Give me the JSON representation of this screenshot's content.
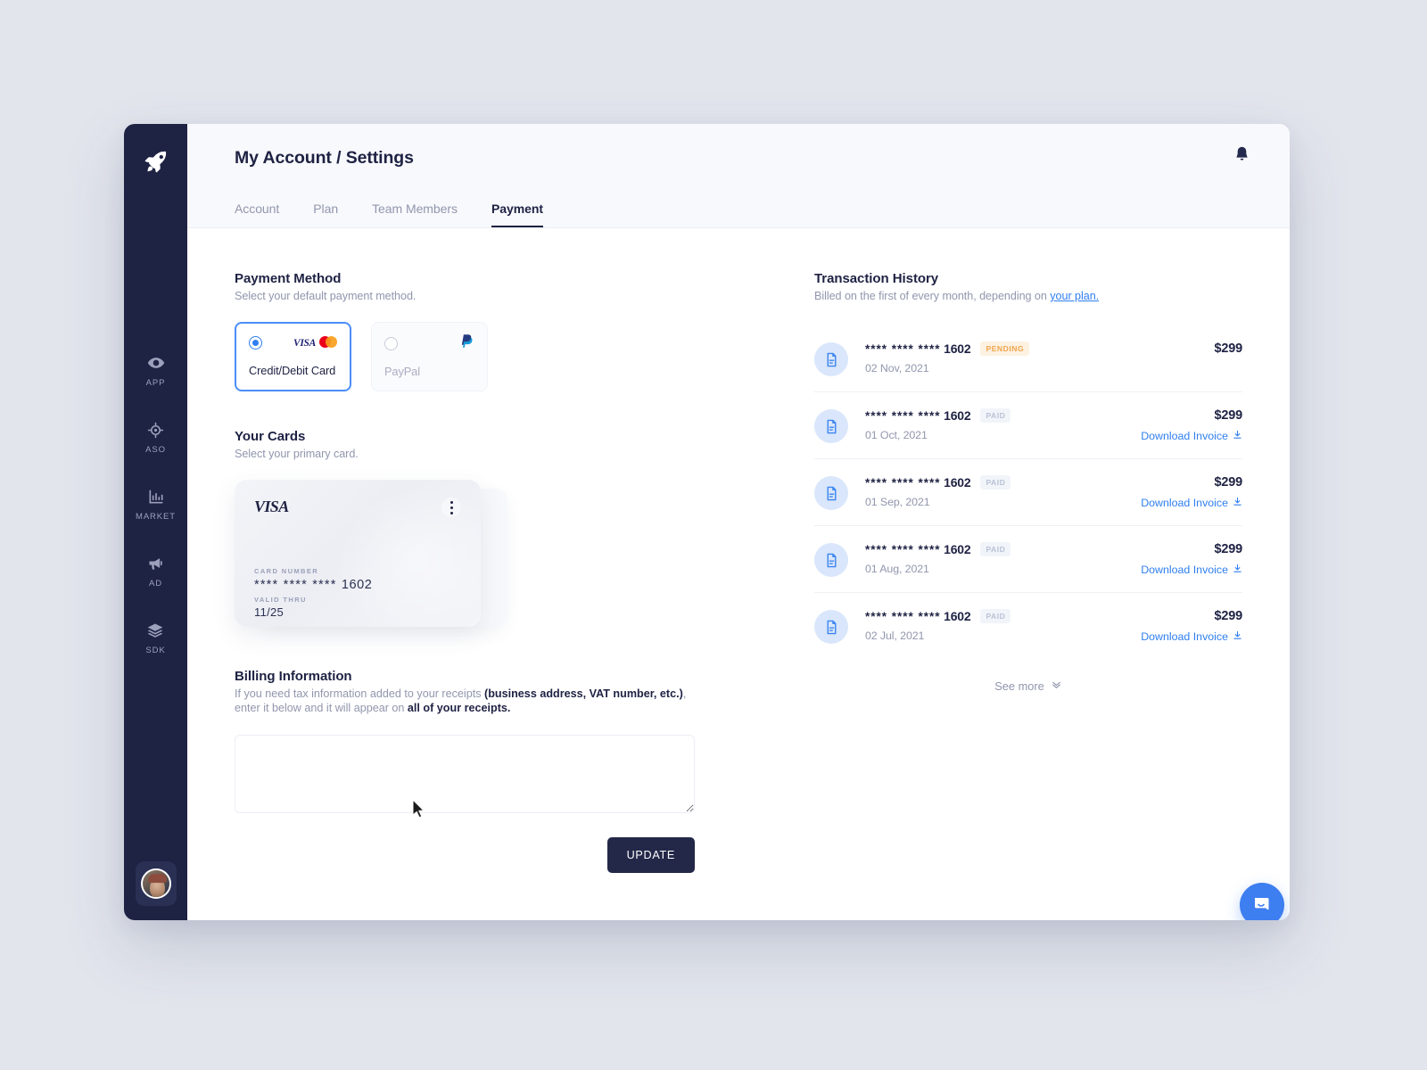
{
  "app": {
    "logo_icon": "rocket-icon",
    "nav": [
      {
        "label": "APP",
        "icon": "eye-icon"
      },
      {
        "label": "ASO",
        "icon": "target-icon"
      },
      {
        "label": "MARKET",
        "icon": "bar-chart-icon"
      },
      {
        "label": "AD",
        "icon": "megaphone-icon"
      },
      {
        "label": "SDK",
        "icon": "layers-icon"
      }
    ],
    "avatar_alt": "user-avatar"
  },
  "header": {
    "title": "My Account / Settings",
    "bell_icon": "bell-icon",
    "tabs": [
      {
        "label": "Account",
        "active": false
      },
      {
        "label": "Plan",
        "active": false
      },
      {
        "label": "Team Members",
        "active": false
      },
      {
        "label": "Payment",
        "active": true
      }
    ]
  },
  "payment_method": {
    "title": "Payment Method",
    "subtitle": "Select your default payment method.",
    "options": [
      {
        "label": "Credit/Debit Card",
        "selected": true,
        "brands": [
          "VISA",
          "mastercard"
        ]
      },
      {
        "label": "PayPal",
        "selected": false,
        "brands": [
          "paypal"
        ]
      }
    ]
  },
  "your_cards": {
    "title": "Your Cards",
    "subtitle": "Select your primary card.",
    "card": {
      "brand": "VISA",
      "card_number_label": "CARD NUMBER",
      "card_number": "**** **** ****",
      "card_last4": "1602",
      "valid_thru_label": "VALID THRU",
      "valid_thru": "11/25",
      "menu_icon": "kebab-menu-icon"
    }
  },
  "billing": {
    "title": "Billing Information",
    "desc_1": "If you need tax information added to your receipts ",
    "desc_bold_1": "(business address, VAT number, etc.)",
    "desc_2": ", enter it below and it will appear on ",
    "desc_bold_2": "all of your receipts.",
    "textarea_value": "",
    "textarea_placeholder": "",
    "update_label": "UPDATE"
  },
  "transactions": {
    "title": "Transaction History",
    "subtitle_prefix": "Billed on the first of every month, depending on ",
    "subtitle_link": "your plan.",
    "download_label": "Download Invoice",
    "see_more_label": "See more",
    "rows": [
      {
        "card": "**** **** ****",
        "last4": "1602",
        "status": "PENDING",
        "status_kind": "pending",
        "date": "02 Nov, 2021",
        "amount": "$299",
        "has_invoice": false
      },
      {
        "card": "**** **** ****",
        "last4": "1602",
        "status": "PAID",
        "status_kind": "paid",
        "date": "01 Oct, 2021",
        "amount": "$299",
        "has_invoice": true
      },
      {
        "card": "**** **** ****",
        "last4": "1602",
        "status": "PAID",
        "status_kind": "paid",
        "date": "01 Sep, 2021",
        "amount": "$299",
        "has_invoice": true
      },
      {
        "card": "**** **** ****",
        "last4": "1602",
        "status": "PAID",
        "status_kind": "paid",
        "date": "01 Aug, 2021",
        "amount": "$299",
        "has_invoice": true
      },
      {
        "card": "**** **** ****",
        "last4": "1602",
        "status": "PAID",
        "status_kind": "paid",
        "date": "02 Jul, 2021",
        "amount": "$299",
        "has_invoice": true
      }
    ]
  },
  "chat": {
    "icon": "chat-bubble-icon"
  },
  "colors": {
    "page_bg": "#e2e5ec",
    "sidebar": "#1e2243",
    "accent_blue": "#2f7ff0",
    "pending": "#f0a44a",
    "paid": "#b9c2d6",
    "dark": "#1e2243"
  }
}
